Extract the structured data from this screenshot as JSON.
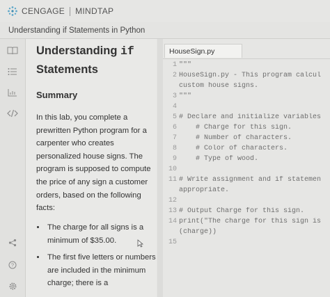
{
  "brand": {
    "name": "CENGAGE",
    "product": "MINDTAP"
  },
  "course_title": "Understanding if Statements in Python",
  "content": {
    "title_prefix": "Understanding ",
    "title_code": "if",
    "title_suffix": "Statements",
    "summary_heading": "Summary",
    "intro": "In this lab, you complete a prewritten Python program for a carpenter who creates personalized house signs. The program is supposed to compute the price of any sign a customer orders, based on the following facts:",
    "bullets": [
      "The charge for all signs is a minimum of $35.00.",
      "The first five letters or numbers are included in the minimum charge; there is a"
    ]
  },
  "editor": {
    "tab_label": "HouseSign.py",
    "lines": [
      {
        "n": "1",
        "text": "\"\"\""
      },
      {
        "n": "2",
        "text": "HouseSign.py - This program calcul"
      },
      {
        "n": "",
        "text": "custom house signs."
      },
      {
        "n": "3",
        "text": "\"\"\""
      },
      {
        "n": "4",
        "text": ""
      },
      {
        "n": "5",
        "text": "# Declare and initialize variables"
      },
      {
        "n": "6",
        "text": "    # Charge for this sign."
      },
      {
        "n": "7",
        "text": "    # Number of characters."
      },
      {
        "n": "8",
        "text": "    # Color of characters."
      },
      {
        "n": "9",
        "text": "    # Type of wood."
      },
      {
        "n": "10",
        "text": ""
      },
      {
        "n": "11",
        "text": "# Write assignment and if statemen"
      },
      {
        "n": "",
        "text": "appropriate."
      },
      {
        "n": "12",
        "text": ""
      },
      {
        "n": "13",
        "text": "# Output Charge for this sign."
      },
      {
        "n": "14",
        "text": "print(\"The charge for this sign is"
      },
      {
        "n": "",
        "text": "(charge))"
      },
      {
        "n": "15",
        "text": ""
      }
    ]
  },
  "icons": [
    "cengage-logo-icon",
    "book-icon",
    "list-icon",
    "chart-icon",
    "code-icon",
    "share-icon",
    "help-icon",
    "settings-icon",
    "mouse-cursor-icon"
  ]
}
